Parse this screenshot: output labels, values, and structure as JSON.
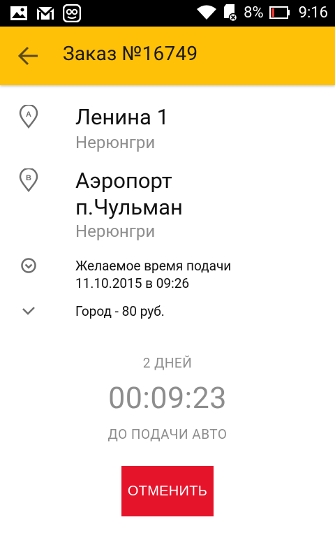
{
  "status_bar": {
    "battery": "8%",
    "time": "9:16",
    "icons": [
      "gallery-icon",
      "gmail-icon",
      "messenger-icon",
      "wifi-icon",
      "sd-card-icon",
      "battery-icon"
    ]
  },
  "app_bar": {
    "title": "Заказ №16749",
    "back_icon": "arrow-back-icon",
    "color": "#FFC107"
  },
  "route": {
    "from": {
      "marker": "A",
      "address": "Ленина 1",
      "city": "Нерюнгри"
    },
    "to": {
      "marker": "B",
      "address_line1": "Аэропорт",
      "address_line2": "п.Чульман",
      "city": "Нерюнгри"
    }
  },
  "details": {
    "pickup_label": "Желаемое время подачи",
    "pickup_datetime": "11.10.2015 в 09:26",
    "pickup_icon": "clock-icon",
    "tariff": "Город - 80 руб.",
    "tariff_icon": "check-icon"
  },
  "countdown": {
    "days": "2 ДНЕЙ",
    "time": "00:09:23",
    "caption": "ДО ПОДАЧИ АВТО"
  },
  "actions": {
    "cancel_label": "ОТМЕНИТЬ",
    "cancel_color": "#E5142B"
  }
}
